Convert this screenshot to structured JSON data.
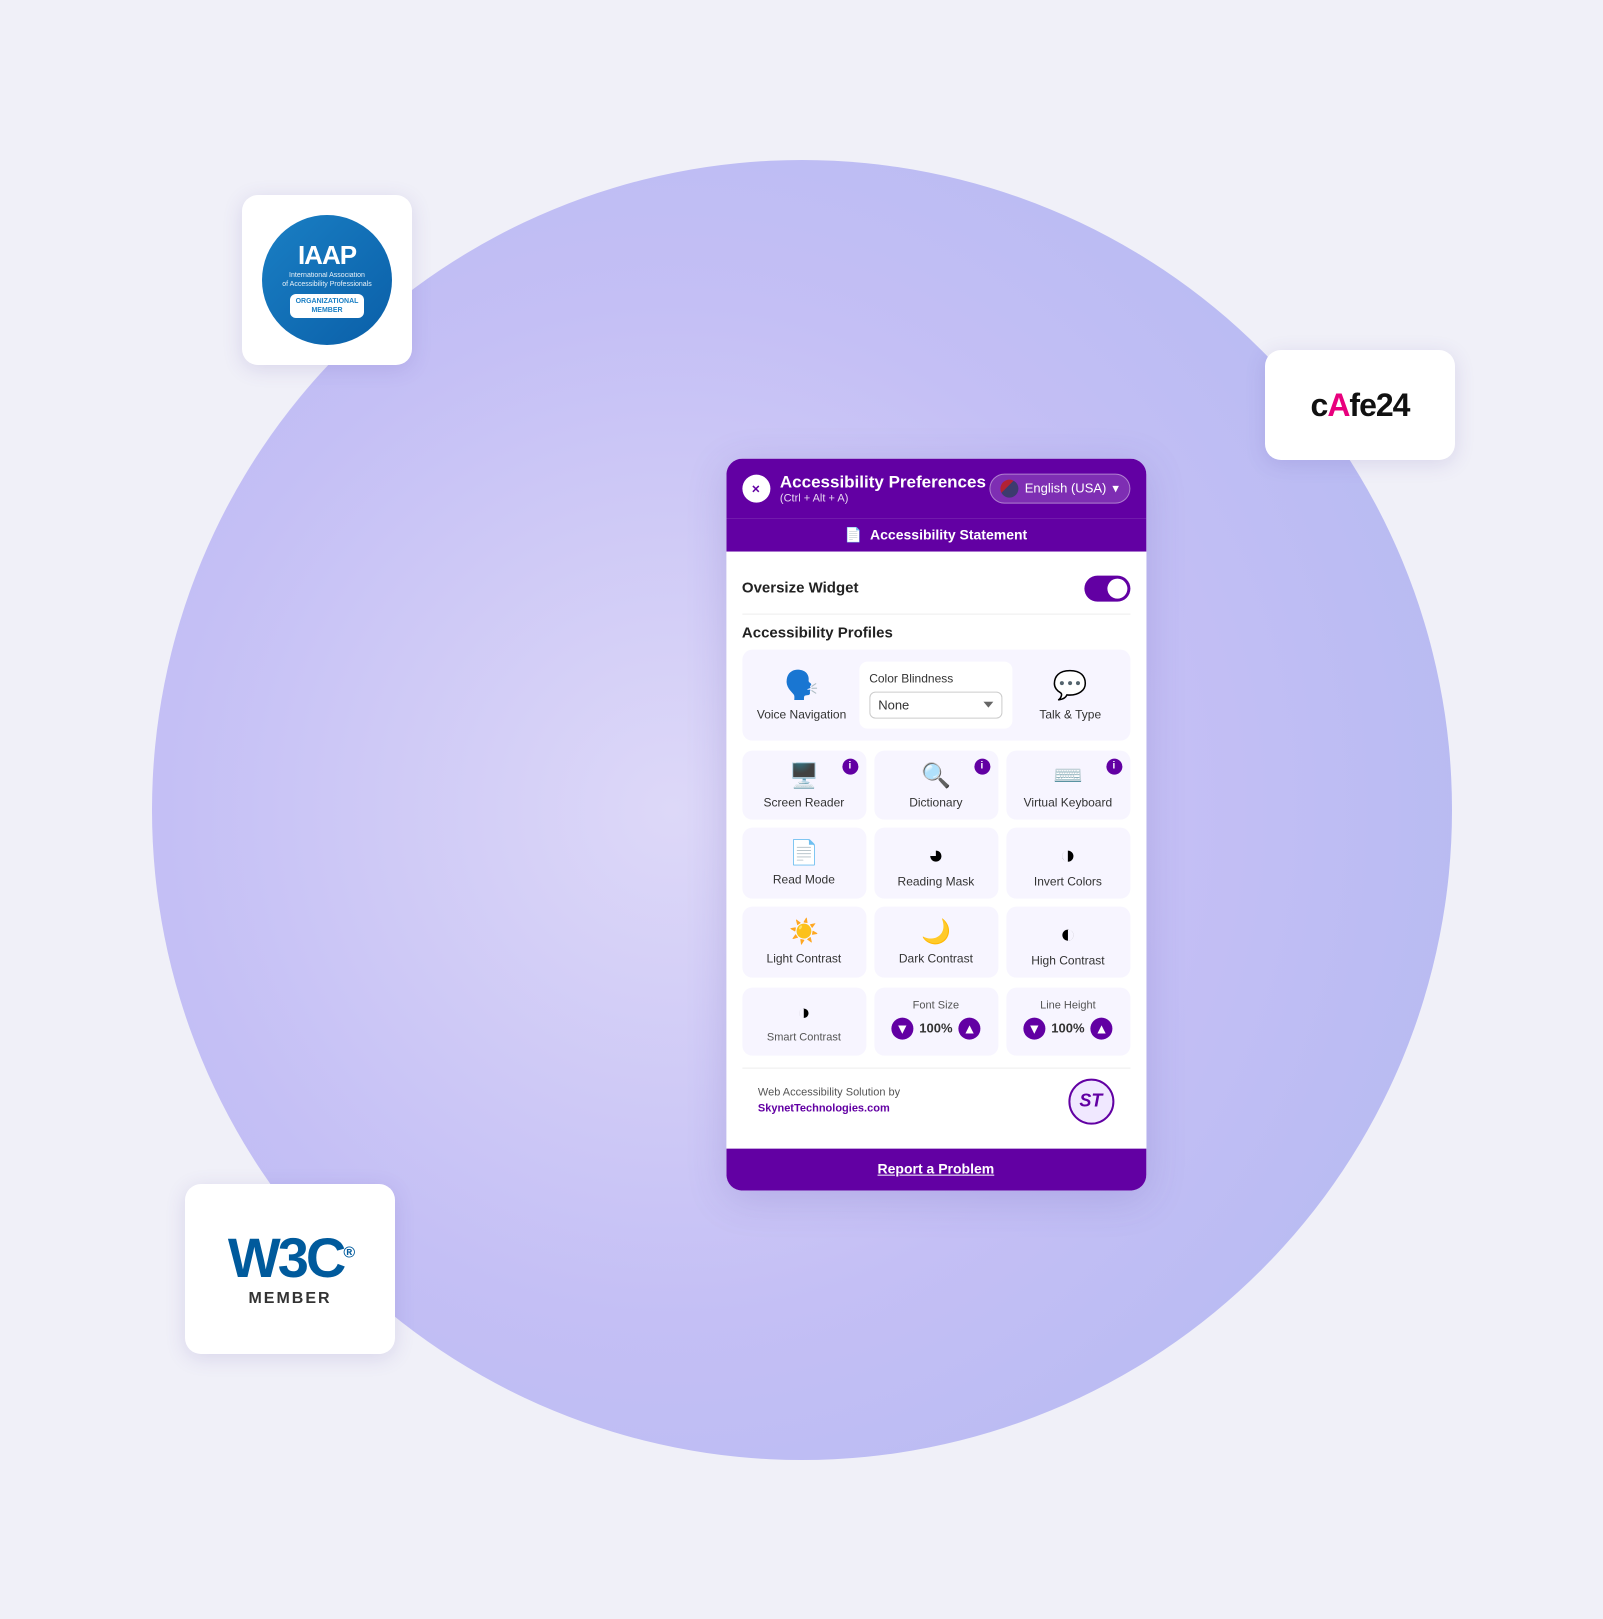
{
  "header": {
    "title": "Accessibility Preferences",
    "shortcut": "(Ctrl + Alt + A)",
    "close_label": "×",
    "lang_label": "English (USA)"
  },
  "stmt_bar": {
    "label": "Accessibility Statement"
  },
  "oversize": {
    "label": "Oversize Widget",
    "toggle_on": true
  },
  "profiles": {
    "label": "Accessibility Profiles"
  },
  "color_blindness": {
    "label": "Color Blindness",
    "default_option": "None"
  },
  "voice_nav": {
    "label": "Voice Navigation"
  },
  "talk_type": {
    "label": "Talk & Type"
  },
  "features": [
    {
      "id": "screen-reader",
      "label": "Screen Reader",
      "icon": "📺",
      "has_info": true
    },
    {
      "id": "dictionary",
      "label": "Dictionary",
      "icon": "🔍",
      "has_info": true
    },
    {
      "id": "virtual-keyboard",
      "label": "Virtual Keyboard",
      "icon": "⌨️",
      "has_info": true
    },
    {
      "id": "read-mode",
      "label": "Read Mode",
      "icon": "📄",
      "has_info": false
    },
    {
      "id": "reading-mask",
      "label": "Reading Mask",
      "icon": "⚫",
      "has_info": false
    },
    {
      "id": "invert-colors",
      "label": "Invert Colors",
      "icon": "◑",
      "has_info": false
    },
    {
      "id": "light-contrast",
      "label": "Light Contrast",
      "icon": "☀",
      "has_info": false
    },
    {
      "id": "dark-contrast",
      "label": "Dark Contrast",
      "icon": "🌙",
      "has_info": false
    },
    {
      "id": "high-contrast",
      "label": "High Contrast",
      "icon": "◐",
      "has_info": false
    }
  ],
  "adjust": [
    {
      "id": "smart-contrast",
      "label": "Smart Contrast",
      "icon": "◑",
      "has_controls": false
    },
    {
      "id": "font-size",
      "label": "Font Size",
      "value": "100%",
      "has_controls": true
    },
    {
      "id": "line-height",
      "label": "Line Height",
      "value": "100%",
      "has_controls": true
    }
  ],
  "footer": {
    "text": "Web Accessibility Solution by",
    "link": "SkynetTechnologies.com",
    "logo_text": "ST"
  },
  "report": {
    "label": "Report a Problem"
  },
  "badges": {
    "iaap": {
      "title": "IAAP",
      "subtitle": "International Association\nof Accessibility Professionals",
      "org_line1": "ORGANIZATIONAL",
      "org_line2": "MEMBER"
    },
    "w3c": {
      "title": "W3C",
      "member": "MEMBER"
    },
    "cafe24": {
      "text": "cafe24"
    }
  }
}
